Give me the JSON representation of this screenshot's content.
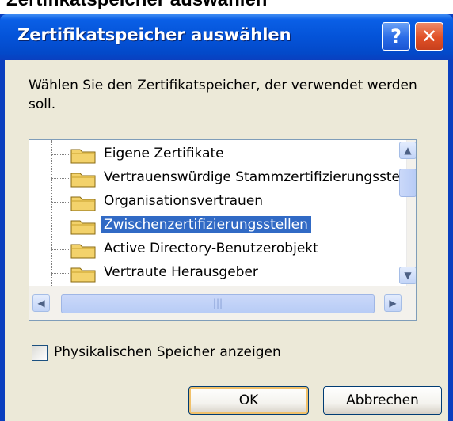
{
  "background": {
    "heading": "Zertifikatspeicher auswählen"
  },
  "window": {
    "title": "Zertifikatspeicher auswählen",
    "help_label": "?",
    "close_label": "✕"
  },
  "prompt": "Wählen Sie den Zertifikatspeicher, der verwendet werden soll.",
  "tree": {
    "items": [
      {
        "label": "Eigene Zertifikate",
        "selected": false
      },
      {
        "label": "Vertrauenswürdige Stammzertifizierungsstellen",
        "selected": false
      },
      {
        "label": "Organisationsvertrauen",
        "selected": false
      },
      {
        "label": "Zwischenzertifizierungsstellen",
        "selected": true
      },
      {
        "label": "Active Directory-Benutzerobjekt",
        "selected": false
      },
      {
        "label": "Vertraute Herausgeber",
        "selected": false
      }
    ],
    "scroll_up": "▲",
    "scroll_down": "▼",
    "scroll_left": "◀",
    "scroll_right": "▶",
    "grip": "|||"
  },
  "checkbox": {
    "label": "Physikalischen Speicher anzeigen",
    "checked": false
  },
  "buttons": {
    "ok": "OK",
    "cancel": "Abbrechen"
  }
}
